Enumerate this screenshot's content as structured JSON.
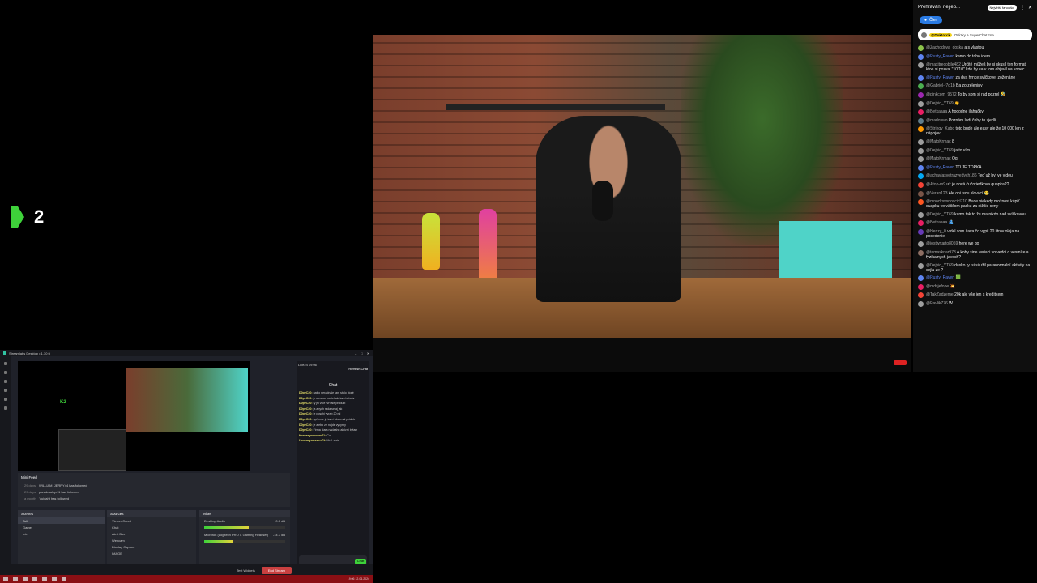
{
  "logo": {
    "number": "2"
  },
  "chat": {
    "title": "Přehrávání nejlep...",
    "top_tag": "Největší fanoušci",
    "join_label": "Člen",
    "pinned": {
      "user": "@Doktorck",
      "text": "Otázky a SuperChat zne..."
    },
    "messages": [
      {
        "user": "@Zachodova_doska",
        "text": "a s vlastou",
        "color": "#8bc34a",
        "mod": false
      },
      {
        "user": "@Rusty_Raven",
        "text": "kamo do toho idem",
        "color": "#5e84f1",
        "mod": true
      },
      {
        "user": "@maxitrecobile482",
        "text": "Určitě můžeš by si skusil ten format ktoe si pozval \"10/10\" kde by sa v tom objevil na konec",
        "color": "#9e9e9e",
        "mod": false
      },
      {
        "user": "@Rusty_Raven",
        "text": "za dva hrnce svíčkovej zoženáne",
        "color": "#5e84f1",
        "mod": true
      },
      {
        "user": "@Gabriel-r7d1b",
        "text": "Ba zo zeleniny",
        "color": "#4caf50",
        "mod": false
      },
      {
        "user": "@pinkcom_9572",
        "text": "To by som si rad pozrel 🤣",
        "color": "#9c27b0",
        "mod": false
      },
      {
        "user": "@Dejvid_YT69",
        "text": "👏",
        "color": "#9e9e9e",
        "mod": false
      },
      {
        "user": "@Betkaaaa",
        "text": "A hooodne ilahačky!",
        "color": "#e91e63",
        "mod": false
      },
      {
        "user": "@marlovwo",
        "text": "Poznám ludí čoby to zjedli",
        "color": "#607d8b",
        "mod": false
      },
      {
        "user": "@Stringy_Kabo",
        "text": "toto bude ale easy ale že 10 000 len z nápojov",
        "color": "#ff9800",
        "mod": false
      },
      {
        "user": "@MatoKrmac",
        "text": "8",
        "color": "#9e9e9e",
        "mod": false
      },
      {
        "user": "@Dejvid_YT69",
        "text": "ja to vím",
        "color": "#9e9e9e",
        "mod": false
      },
      {
        "user": "@MatoKrmac",
        "text": "Og",
        "color": "#9e9e9e",
        "mod": false
      },
      {
        "user": "@Rusty_Raven",
        "text": "TO JE TOPKA",
        "color": "#5e84f1",
        "mod": true
      },
      {
        "user": "@achaviasvetrazvedych186",
        "text": "Teď už byl ve videu",
        "color": "#03a9f4",
        "mod": false
      },
      {
        "user": "@Atop-m9",
        "text": "už je nová čučoriedkova quapka??",
        "color": "#f44336",
        "mod": false
      },
      {
        "user": "@Veran123",
        "text": "Ale oni jsou slovácí 😂",
        "color": "#795548",
        "mod": false
      },
      {
        "user": "@mnocksvsnoscicl710",
        "text": "Bude niekedy možnost kúpiť quapku vo väčšom packu za nižšie ceny",
        "color": "#ff5722",
        "mod": false
      },
      {
        "user": "@Dejvid_YT69",
        "text": "kamo tak to že ma nikdo nad svíčkovou",
        "color": "#9e9e9e",
        "mod": false
      },
      {
        "user": "@Betkaaaa",
        "text": "🫂",
        "color": "#e91e63",
        "mod": false
      },
      {
        "user": "@Henzy_0",
        "text": "videl som čava čo vypil 20 litrov oleja na posedenie",
        "color": "#673ab7",
        "mod": false
      },
      {
        "user": "@jostwrtarto8059",
        "text": "here we go",
        "color": "#9e9e9e",
        "mod": false
      },
      {
        "user": "@tomaskrlar973",
        "text": "A koby sine veriaci vo vedci o vesmíre a fyzikalnych javoch?",
        "color": "#8d6e63",
        "mod": false
      },
      {
        "user": "@Dejvid_YT69",
        "text": "dasko ty jsi si užil paranormalní aktivity na cejlu ze ?",
        "color": "#9e9e9e",
        "mod": false
      },
      {
        "user": "@Rusty_Raven",
        "text": "🟩",
        "color": "#5e84f1",
        "mod": true
      },
      {
        "user": "@mdsjefope",
        "text": "💥",
        "color": "#e91e63",
        "mod": false
      },
      {
        "user": "@TakZadzeme",
        "text": "20k ale vše jen s kreditkem",
        "color": "#f44336",
        "mod": false
      },
      {
        "user": "@Pavlik776",
        "text": "W",
        "color": "#9e9e9e",
        "mod": false
      }
    ]
  },
  "obs": {
    "title": "Streamlabs Desktop • 1.30 ft",
    "chat_title": "Chat",
    "chat_header": "Live24 19:06",
    "chat_refresh": "Refresh Chat",
    "chat_lines": [
      {
        "user": "D0pvC20:",
        "text": "našlo neradnale tam stolo ktoré"
      },
      {
        "user": "D0pvC20:",
        "text": "je alespon rodiel ale tam bebets"
      },
      {
        "user": "D0pvC20:",
        "text": "ty jsi více NH ale produkt"
      },
      {
        "user": "D0pvC20:",
        "text": "ja abych rada se aj jak"
      },
      {
        "user": "D0pvC20:",
        "text": "je poschi vyrab 20 ml"
      },
      {
        "user": "D0pvC20:",
        "text": "upřímne je tam i obremal prášek"
      },
      {
        "user": "D0pvC20:",
        "text": "je alebo ze najde vycyrny"
      },
      {
        "user": "D0pvC20:",
        "text": "Firma klara nadzahu aktivní bylam"
      },
      {
        "user": "Honzaeyodsslev71:",
        "text": "Co"
      },
      {
        "user": "Honzaeyodsslev71:",
        "text": "Mně v sie"
      }
    ],
    "chat_send": "Chat",
    "minifeed_title": "Mini Feed",
    "minifeed": [
      {
        "time": "29 days",
        "text": "WILLIAM_JERRY44  has followed"
      },
      {
        "time": "29 days",
        "text": "paradmalbyr11  has followed"
      },
      {
        "time": "a month",
        "text": "Vujdaht  has followed"
      }
    ],
    "scenes_title": "Scenes",
    "scenes": [
      "Talk",
      "Game",
      "Intr"
    ],
    "sources_title": "Sources",
    "sources": [
      "Viewer Count",
      "Chat",
      "Alert Box",
      "Webcam",
      "Display Capture",
      "IMAGE"
    ],
    "mixer_title": "Mixer",
    "mixer": [
      {
        "name": "Desktop Audio",
        "value": "0.0 dB",
        "level": 0.55
      },
      {
        "name": "Microfon (Logitech PRO X Gaming Headset)",
        "value": "-14.7 dB",
        "level": 0.35
      }
    ],
    "status_test": "Test Widgets",
    "go_live": "End Stream"
  },
  "taskbar": {
    "clock": "19:06 12.04.2024"
  }
}
